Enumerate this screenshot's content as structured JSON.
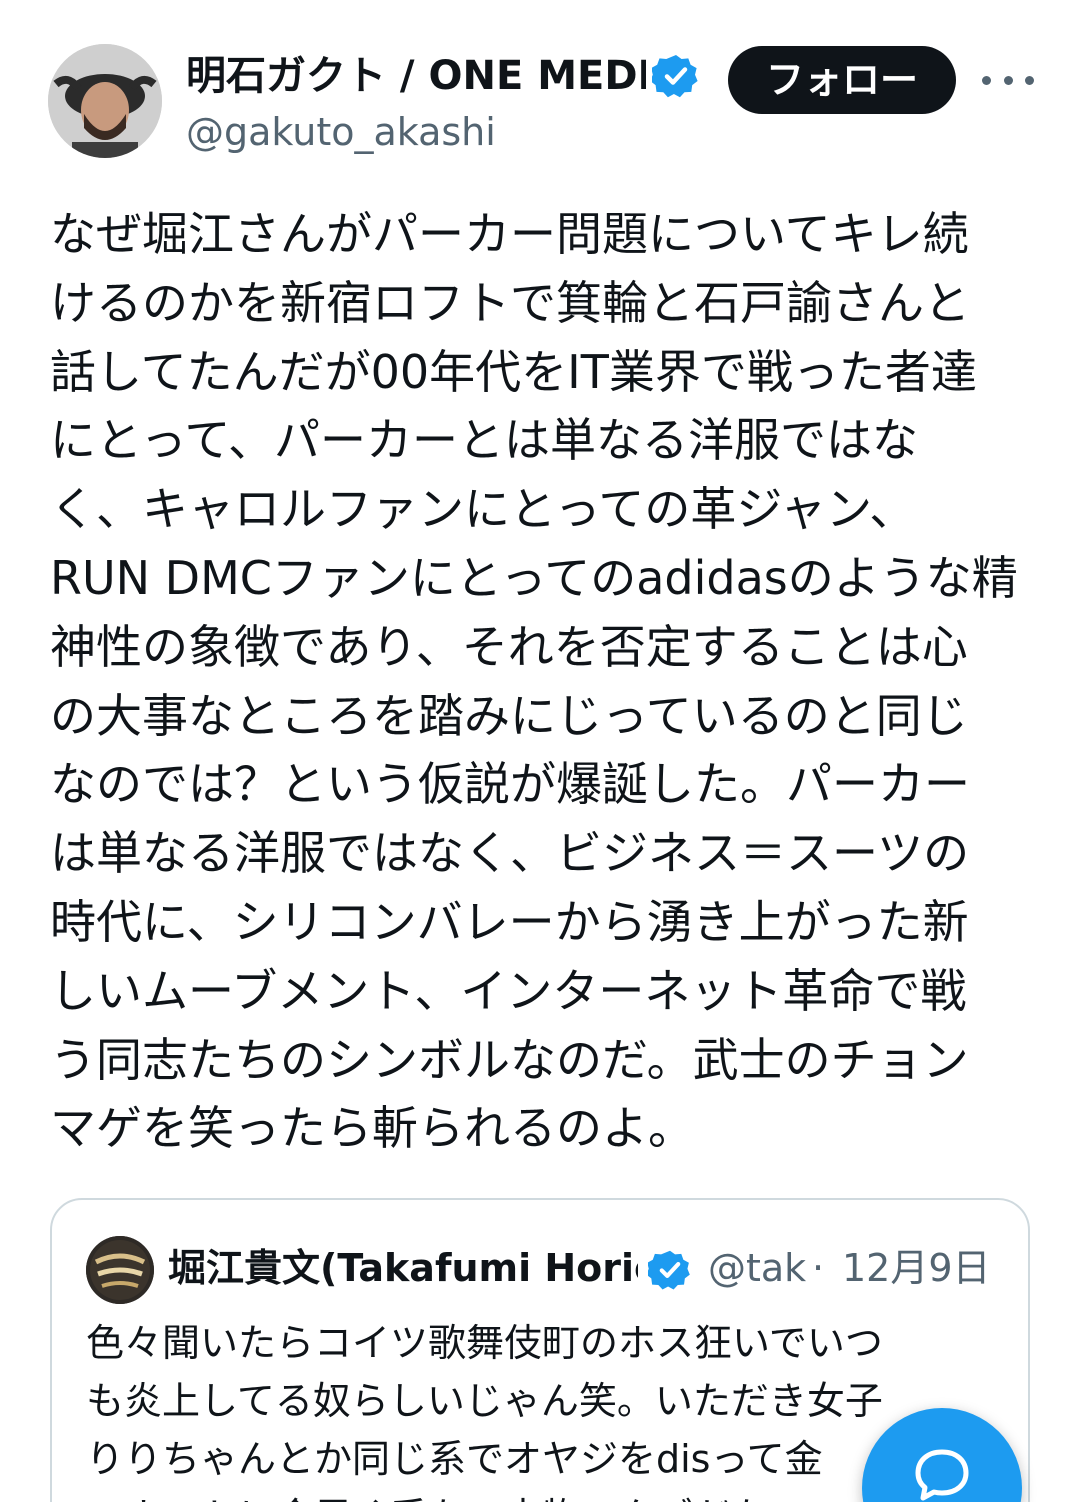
{
  "author": {
    "display_name": "明石ガクト / ONE MEDIA",
    "handle": "@gakuto_akashi",
    "verified_icon": "verified-badge-icon",
    "avatar_icon": "avatar-photo"
  },
  "actions": {
    "follow_label": "フォロー",
    "more_icon": "more-options-icon"
  },
  "tweet": {
    "text": "なぜ堀江さんがパーカー問題についてキレ続\nけるのかを新宿ロフトで箕輪と石戸諭さんと\n話してたんだが00年代をIT業界で戦った者達\nにとって、パーカーとは単なる洋服ではな\nく、キャロルファンにとっての革ジャン、\nRUN DMCファンにとってのadidasのような精\n神性の象徴であり、それを否定することは心\nの大事なところを踏みにじっているのと同じ\nなのでは？という仮説が爆誕した。パーカー\nは単なる洋服ではなく、ビジネス＝スーツの\n時代に、シリコンバレーから湧き上がった新\nしいムーブメント、インターネット革命で戦\nう同志たちのシンボルなのだ。武士のチョン\nマゲを笑ったら斬られるのよ。"
  },
  "quote": {
    "display_name": "堀江貴文(Takafumi Horie",
    "handle": "@tak",
    "separator": "·",
    "date": "12月9日",
    "text": "色々聞いたらコイツ歌舞伎町のホス狂いでいつ\nも炎上してる奴らしいじゃん笑。いただき女子\nりりちゃんとか同じ系でオヤジをdisって金\nでホストに金貢ぐ系な。本物のクズだな"
  },
  "colors": {
    "text": "#0f1419",
    "secondary": "#536471",
    "accent": "#1d9bf0",
    "border": "#cfd9de"
  },
  "fab": {
    "icon": "compose-message-icon"
  }
}
